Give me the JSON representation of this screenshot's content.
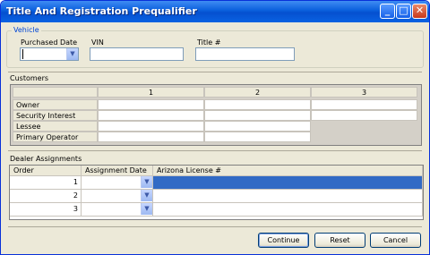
{
  "window": {
    "title": "Title And Registration Prequalifier"
  },
  "vehicle": {
    "label": "Vehicle",
    "purchased_date_label": "Purchased Date",
    "purchased_date_value": "",
    "vin_label": "VIN",
    "vin_value": "",
    "title_label": "Title #",
    "title_value": ""
  },
  "customers": {
    "label": "Customers",
    "columns": [
      "1",
      "2",
      "3"
    ],
    "rows": [
      "Owner",
      "Security Interest",
      "Lessee",
      "Primary Operator"
    ]
  },
  "dealer": {
    "label": "Dealer Assignments",
    "headers": [
      "Order",
      "Assignment Date",
      "Arizona License #"
    ],
    "rows": [
      {
        "order": "1",
        "date": "",
        "license": ""
      },
      {
        "order": "2",
        "date": "",
        "license": ""
      },
      {
        "order": "3",
        "date": "",
        "license": ""
      }
    ]
  },
  "buttons": {
    "continue": "Continue",
    "reset": "Reset",
    "cancel": "Cancel"
  },
  "colors": {
    "title_bar": "#0a5fdc",
    "selection": "#316ac5",
    "face": "#ece9d8"
  }
}
